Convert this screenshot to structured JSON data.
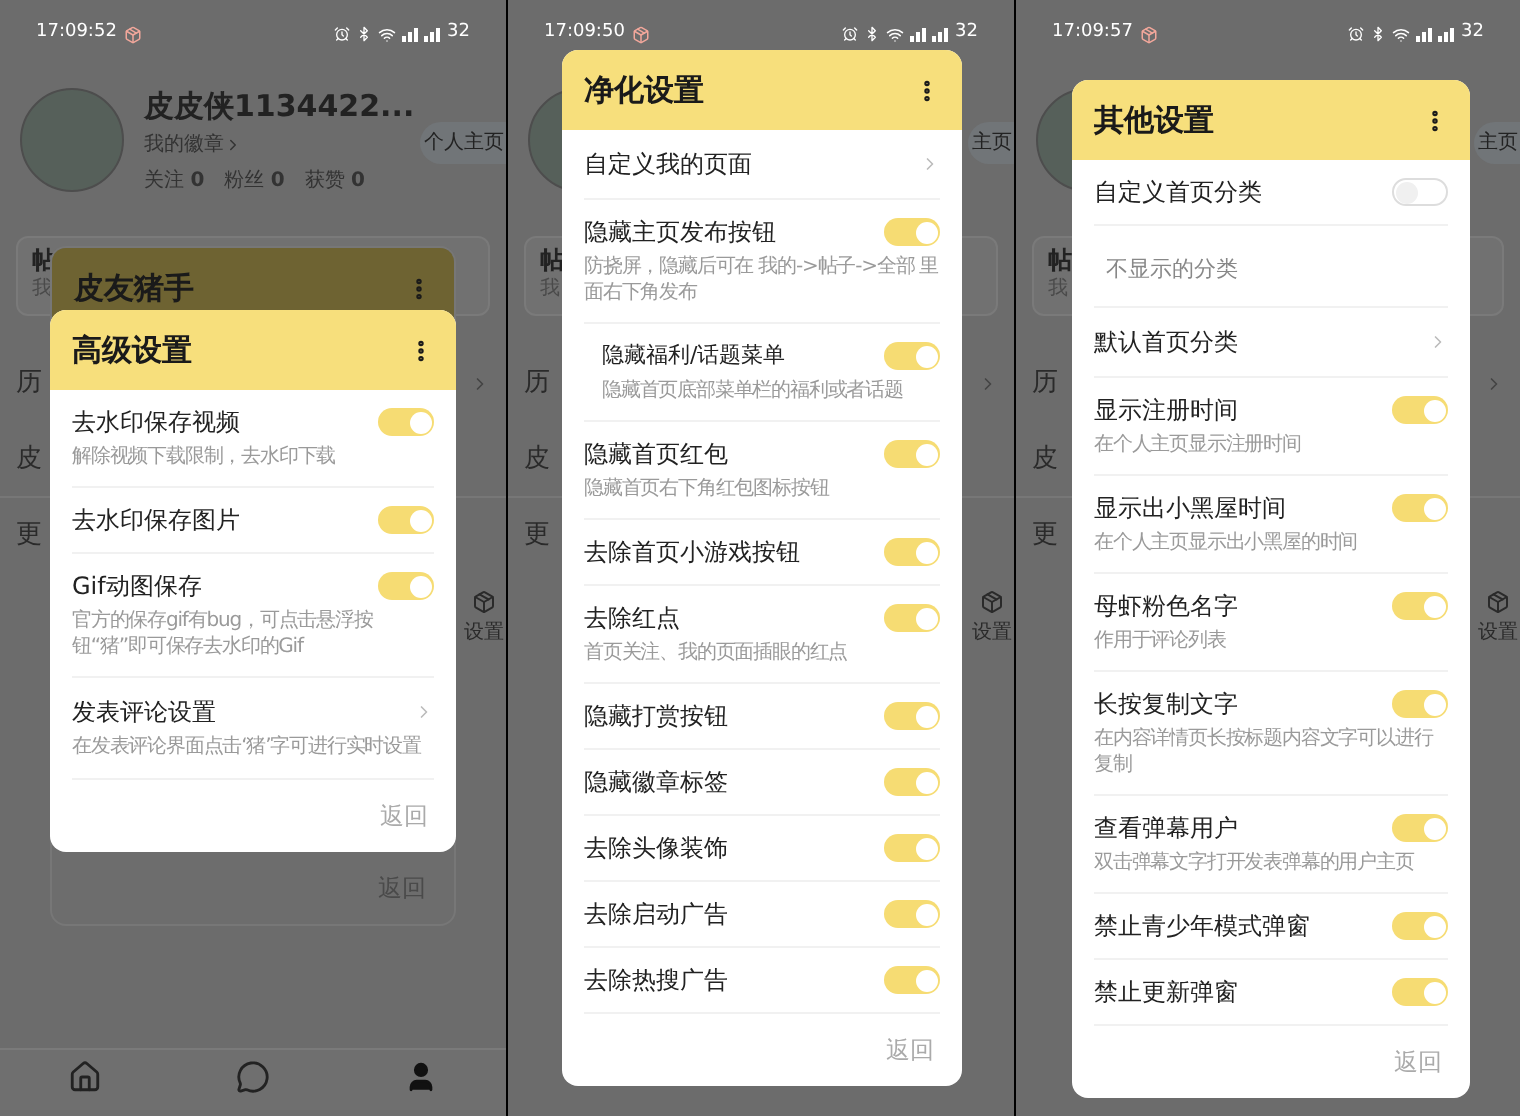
{
  "phones": [
    {
      "status_bar": {
        "time": "17:09:52",
        "battery": "32"
      },
      "background": {
        "name": "皮皮侠1134422...",
        "badge": "我的徽章",
        "stats": [
          {
            "label": "关注",
            "value": "0"
          },
          {
            "label": "粉丝",
            "value": "0"
          },
          {
            "label": "获赞",
            "value": "0"
          }
        ],
        "home_button": "个人主页",
        "card_title": "帖",
        "card_subtitle": "我",
        "rows": [
          {
            "label": "历",
            "chevron": true
          },
          {
            "label": "皮",
            "chevron": false
          },
          {
            "label": "更",
            "chevron": false
          }
        ],
        "tool_label": "设置",
        "bottom_nav": true
      },
      "behind_dialog": {
        "title": "皮友猪手",
        "back": "返回"
      },
      "dialog": {
        "title": "高级设置",
        "back": "返回",
        "items": [
          {
            "kind": "toggle",
            "title": "去水印保存视频",
            "subtitle": "解除视频下载限制，去水印下载",
            "on": true
          },
          {
            "kind": "toggle",
            "title": "去水印保存图片",
            "on": true
          },
          {
            "kind": "toggle",
            "title": "Gif动图保存",
            "subtitle": "官方的保存gif有bug，可点击悬浮按钮“猪”即可保存去水印的Gif",
            "on": true
          },
          {
            "kind": "link",
            "title": "发表评论设置",
            "subtitle": "在发表评论界面点击‘猪’字可进行实时设置"
          }
        ]
      }
    },
    {
      "status_bar": {
        "time": "17:09:50",
        "battery": "32"
      },
      "background": {
        "home_button": "主页",
        "card_title": "帖",
        "card_subtitle": "我",
        "rows": [
          {
            "label": "历",
            "chevron": true
          },
          {
            "label": "皮",
            "chevron": false
          },
          {
            "label": "更",
            "chevron": false
          }
        ],
        "tool_label": "设置",
        "bottom_nav": false
      },
      "dialog": {
        "title": "净化设置",
        "back": "返回",
        "items": [
          {
            "kind": "link",
            "title": "自定义我的页面"
          },
          {
            "kind": "toggle",
            "title": "隐藏主页发布按钮",
            "subtitle": "防挠屏，隐藏后可在 我的->帖子->全部 里面右下角发布",
            "on": true
          },
          {
            "kind": "subtoggle",
            "title": "隐藏福利/话题菜单",
            "subtitle": "隐藏首页底部菜单栏的福利或者话题",
            "on": true
          },
          {
            "kind": "toggle",
            "title": "隐藏首页红包",
            "subtitle": "隐藏首页右下角红包图标按钮",
            "on": true
          },
          {
            "kind": "toggle",
            "title": "去除首页小游戏按钮",
            "on": true
          },
          {
            "kind": "toggle",
            "title": "去除红点",
            "subtitle": "首页关注、我的页面插眼的红点",
            "on": true
          },
          {
            "kind": "toggle",
            "title": "隐藏打赏按钮",
            "on": true
          },
          {
            "kind": "toggle",
            "title": "隐藏徽章标签",
            "on": true
          },
          {
            "kind": "toggle",
            "title": "去除头像装饰",
            "on": true
          },
          {
            "kind": "toggle",
            "title": "去除启动广告",
            "on": true
          },
          {
            "kind": "toggle",
            "title": "去除热搜广告",
            "on": true
          }
        ]
      }
    },
    {
      "status_bar": {
        "time": "17:09:57",
        "battery": "32"
      },
      "background": {
        "home_button": "主页",
        "card_title": "帖",
        "card_subtitle": "我",
        "rows": [
          {
            "label": "历",
            "chevron": true
          },
          {
            "label": "皮",
            "chevron": false
          },
          {
            "label": "更",
            "chevron": false
          }
        ],
        "tool_label": "设置",
        "bottom_nav": false
      },
      "dialog": {
        "title": "其他设置",
        "back": "返回",
        "items": [
          {
            "kind": "toggle",
            "title": "自定义首页分类",
            "on": false
          },
          {
            "kind": "label",
            "title": "不显示的分类"
          },
          {
            "kind": "link",
            "title": "默认首页分类"
          },
          {
            "kind": "toggle",
            "title": "显示注册时间",
            "subtitle": "在个人主页显示注册时间",
            "on": true
          },
          {
            "kind": "toggle",
            "title": "显示出小黑屋时间",
            "subtitle": "在个人主页显示出小黑屋的时间",
            "on": true
          },
          {
            "kind": "toggle",
            "title": "母虾粉色名字",
            "subtitle": "作用于评论列表",
            "on": true
          },
          {
            "kind": "toggle",
            "title": "长按复制文字",
            "subtitle": "在内容详情页长按标题内容文字可以进行复制",
            "on": true
          },
          {
            "kind": "toggle",
            "title": "查看弹幕用户",
            "subtitle": "双击弹幕文字打开发表弹幕的用户主页",
            "on": true
          },
          {
            "kind": "toggle",
            "title": "禁止青少年模式弹窗",
            "on": true
          },
          {
            "kind": "toggle",
            "title": "禁止更新弹窗",
            "on": true
          }
        ]
      }
    }
  ]
}
